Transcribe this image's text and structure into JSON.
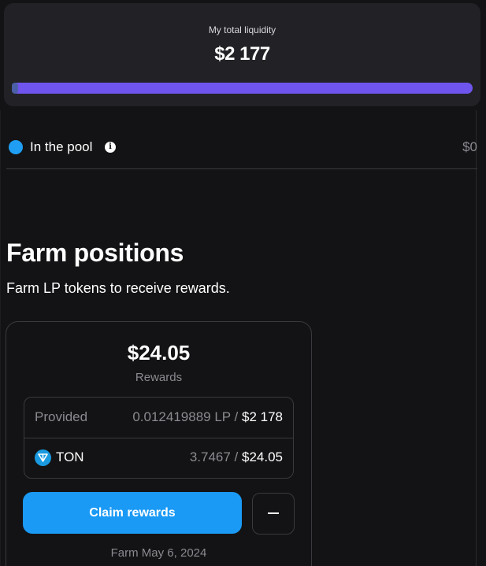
{
  "liquidity": {
    "label": "My total liquidity",
    "value": "$2 177",
    "bar_fill_fraction": 1.0,
    "bar_color": "#6f55ee"
  },
  "pool": {
    "label": "In the pool",
    "value": "$0",
    "dot_color": "#1f9ef4",
    "info_icon": "info-icon"
  },
  "farm": {
    "title": "Farm positions",
    "subtitle": "Farm LP tokens to receive rewards.",
    "card": {
      "rewards_value": "$24.05",
      "rewards_label": "Rewards",
      "provided_label": "Provided",
      "provided_amount": "0.012419889 LP",
      "provided_separator": " / ",
      "provided_usd": "$2 178",
      "token_label": "TON",
      "token_icon": "ton-icon",
      "token_amount": "3.7467",
      "token_separator": " / ",
      "token_usd": "$24.05",
      "claim_button": "Claim rewards",
      "minus_icon": "minus-icon",
      "date": "Farm May 6, 2024"
    }
  },
  "colors": {
    "background": "#131315",
    "card": "#222226",
    "accent_blue": "#1a9af5",
    "muted_text": "#8a8a90"
  }
}
